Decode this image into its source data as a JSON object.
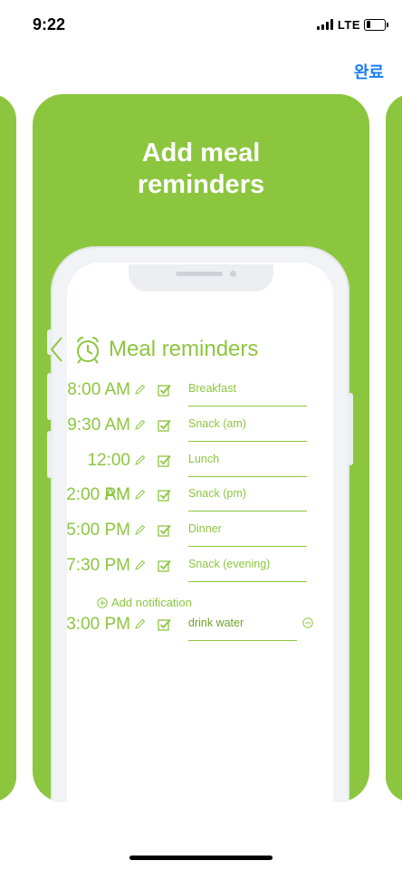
{
  "status_bar": {
    "time": "9:22",
    "network": "LTE",
    "battery_level": 0.25
  },
  "header": {
    "done_label": "완료"
  },
  "card": {
    "title": "Add meal\nreminders",
    "background": "#8cc63f"
  },
  "screen": {
    "title": "Meal reminders",
    "accent": "#8cc63f",
    "reminders": [
      {
        "time": "8:00 AM",
        "meal": "Breakfast",
        "checked": true
      },
      {
        "time": "9:30 AM",
        "meal": "Snack (am)",
        "checked": true
      },
      {
        "time": "12:00 AM",
        "meal": "Lunch",
        "checked": true
      },
      {
        "time": "2:00 PM",
        "meal": "Snack (pm)",
        "checked": true
      },
      {
        "time": "5:00 PM",
        "meal": "Dinner",
        "checked": true
      },
      {
        "time": "7:30 PM",
        "meal": "Snack (evening)",
        "checked": true
      }
    ],
    "add_notification_label": "Add notification",
    "custom_reminder": {
      "time": "3:00 PM",
      "meal": "drink water",
      "checked": true
    }
  },
  "link_color": "#1a7cf5"
}
